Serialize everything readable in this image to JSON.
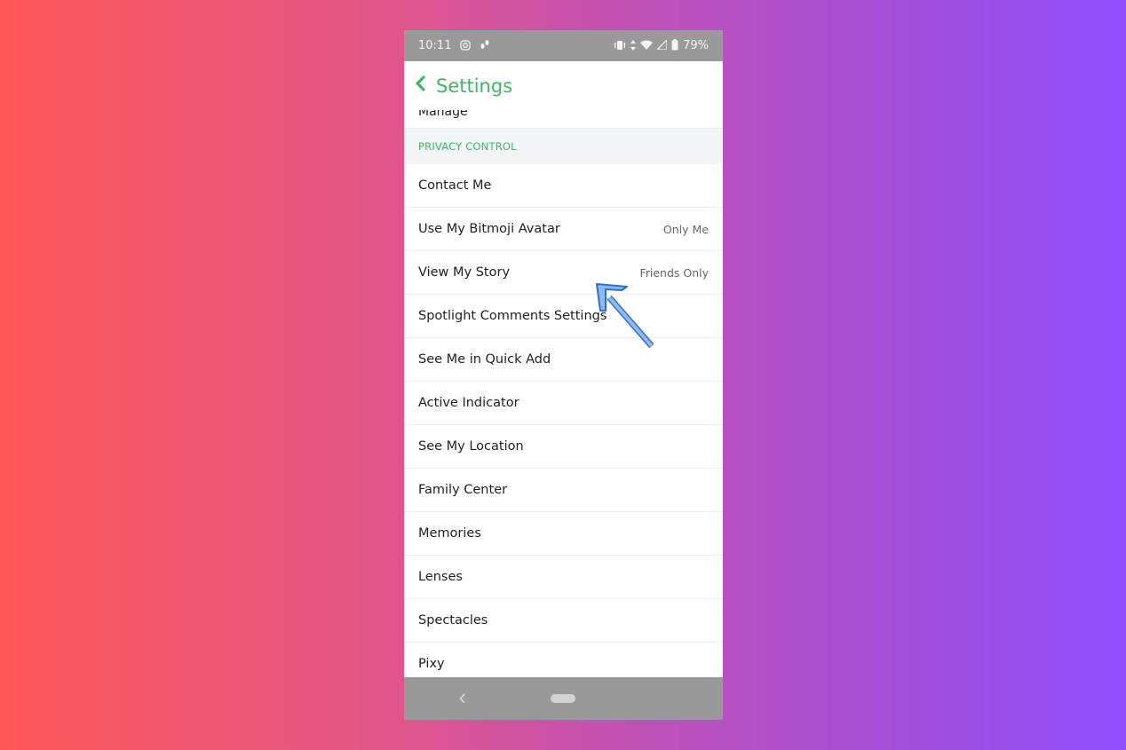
{
  "status_bar": {
    "time": "10:11",
    "left_icons": [
      "instagram-icon",
      "notification-icon"
    ],
    "right_icons": [
      "vibrate-icon",
      "data-arrows-icon",
      "wifi-icon",
      "signal-icon",
      "battery-icon"
    ],
    "battery": "79%"
  },
  "header": {
    "back_icon": "chevron-left-icon",
    "title": "Settings"
  },
  "partial_row": {
    "label": "Manage"
  },
  "section": {
    "title": "PRIVACY CONTROL"
  },
  "items": [
    {
      "label": "Contact Me",
      "value": ""
    },
    {
      "label": "Use My Bitmoji Avatar",
      "value": "Only Me"
    },
    {
      "label": "View My Story",
      "value": "Friends Only"
    },
    {
      "label": "Spotlight Comments Settings",
      "value": ""
    },
    {
      "label": "See Me in Quick Add",
      "value": ""
    },
    {
      "label": "Active Indicator",
      "value": ""
    },
    {
      "label": "See My Location",
      "value": ""
    },
    {
      "label": "Family Center",
      "value": ""
    },
    {
      "label": "Memories",
      "value": ""
    },
    {
      "label": "Lenses",
      "value": ""
    },
    {
      "label": "Spectacles",
      "value": ""
    },
    {
      "label": "Pixy",
      "value": ""
    }
  ],
  "nav_bar": {
    "back_icon": "nav-back-icon",
    "home_icon": "home-pill-icon"
  },
  "annotation": {
    "icon": "arrow-annotation-icon",
    "points_to": "View My Story",
    "color": "#5b9cf0"
  },
  "colors": {
    "accent": "#3db865",
    "bar_gray": "#999999"
  }
}
